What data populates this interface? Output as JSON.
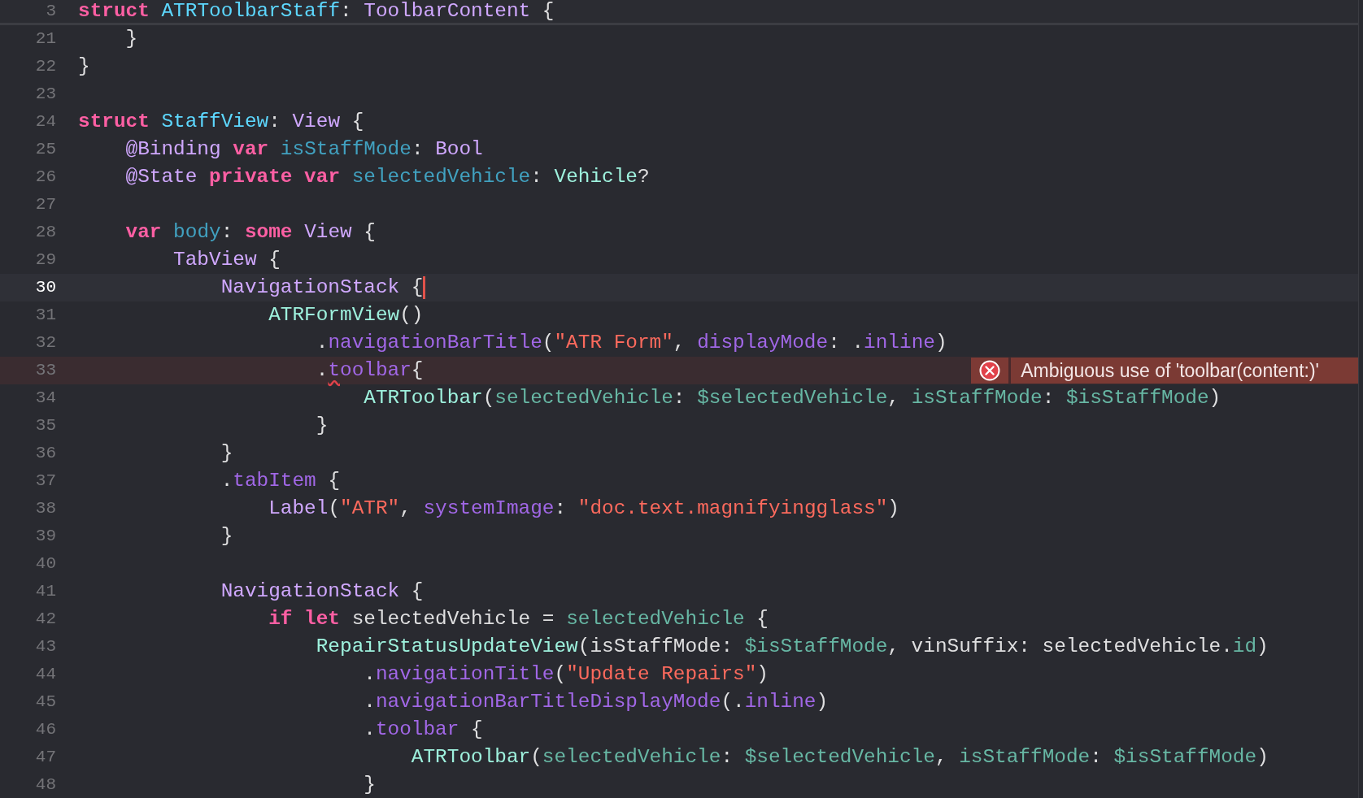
{
  "sticky_header": {
    "number": "3",
    "tokens": [
      {
        "text": "struct",
        "kind": "keyword"
      },
      {
        "text": " ATRToolbarStaff",
        "kind": "decl-type"
      },
      {
        "text": ": ",
        "kind": "plain"
      },
      {
        "text": "ToolbarContent",
        "kind": "sys-type"
      },
      {
        "text": " {",
        "kind": "plain"
      }
    ]
  },
  "lines": [
    {
      "number": "21",
      "current": false,
      "tokens": [
        {
          "text": "    }",
          "kind": "plain"
        }
      ]
    },
    {
      "number": "22",
      "current": false,
      "tokens": [
        {
          "text": "}",
          "kind": "plain"
        }
      ]
    },
    {
      "number": "23",
      "current": false
    },
    {
      "number": "24",
      "current": false,
      "tokens": [
        {
          "text": "struct",
          "kind": "keyword"
        },
        {
          "text": " StaffView",
          "kind": "decl-type"
        },
        {
          "text": ": ",
          "kind": "plain"
        },
        {
          "text": "View",
          "kind": "sys-type"
        },
        {
          "text": " {",
          "kind": "plain"
        }
      ]
    },
    {
      "number": "25",
      "current": false,
      "tokens": [
        {
          "text": "    @Binding",
          "kind": "sys-type"
        },
        {
          "text": " var",
          "kind": "keyword"
        },
        {
          "text": " isStaffMode",
          "kind": "decl-var"
        },
        {
          "text": ": ",
          "kind": "plain"
        },
        {
          "text": "Bool",
          "kind": "sys-type"
        }
      ]
    },
    {
      "number": "26",
      "current": false,
      "tokens": [
        {
          "text": "    @State",
          "kind": "sys-type"
        },
        {
          "text": " private var",
          "kind": "keyword"
        },
        {
          "text": " selectedVehicle",
          "kind": "decl-var"
        },
        {
          "text": ": ",
          "kind": "plain"
        },
        {
          "text": "Vehicle",
          "kind": "proj-type"
        },
        {
          "text": "?",
          "kind": "plain"
        }
      ]
    },
    {
      "number": "27",
      "current": false
    },
    {
      "number": "28",
      "current": false,
      "tokens": [
        {
          "text": "    var",
          "kind": "keyword"
        },
        {
          "text": " body",
          "kind": "decl-var"
        },
        {
          "text": ": ",
          "kind": "plain"
        },
        {
          "text": "some",
          "kind": "keyword"
        },
        {
          "text": " View",
          "kind": "sys-type"
        },
        {
          "text": " {",
          "kind": "plain"
        }
      ]
    },
    {
      "number": "29",
      "current": false,
      "tokens": [
        {
          "text": "        TabView",
          "kind": "sys-type"
        },
        {
          "text": " {",
          "kind": "plain"
        }
      ]
    },
    {
      "number": "30",
      "current": true,
      "tokens": [
        {
          "text": "            NavigationStack",
          "kind": "sys-type"
        },
        {
          "text": " {",
          "kind": "plain"
        }
      ]
    },
    {
      "number": "31",
      "current": false,
      "tokens": [
        {
          "text": "                ATRFormView",
          "kind": "proj-type"
        },
        {
          "text": "()",
          "kind": "plain"
        }
      ]
    },
    {
      "number": "32",
      "current": false,
      "tokens": [
        {
          "text": "                    .",
          "kind": "plain"
        },
        {
          "text": "navigationBarTitle",
          "kind": "sys-member"
        },
        {
          "text": "(",
          "kind": "plain"
        },
        {
          "text": "\"ATR Form\"",
          "kind": "string"
        },
        {
          "text": ", ",
          "kind": "plain"
        },
        {
          "text": "displayMode",
          "kind": "sys-member"
        },
        {
          "text": ": .",
          "kind": "plain"
        },
        {
          "text": "inline",
          "kind": "sys-member"
        },
        {
          "text": ")",
          "kind": "plain"
        }
      ]
    },
    {
      "number": "33",
      "current": false,
      "error": {
        "message": "Ambiguous use of 'toolbar(content:)'"
      },
      "tokens": [
        {
          "text": "                    .",
          "kind": "plain"
        },
        {
          "text": "t",
          "kind": "error-member"
        },
        {
          "text": "oolbar",
          "kind": "sys-member"
        },
        {
          "text": "{",
          "kind": "plain"
        }
      ]
    },
    {
      "number": "34",
      "current": false,
      "tokens": [
        {
          "text": "                        ATRToolbar",
          "kind": "proj-type"
        },
        {
          "text": "(",
          "kind": "plain"
        },
        {
          "text": "selectedVehicle",
          "kind": "proj-member"
        },
        {
          "text": ": ",
          "kind": "plain"
        },
        {
          "text": "$selectedVehicle",
          "kind": "proj-member"
        },
        {
          "text": ", ",
          "kind": "plain"
        },
        {
          "text": "isStaffMode",
          "kind": "proj-member"
        },
        {
          "text": ": ",
          "kind": "plain"
        },
        {
          "text": "$isStaffMode",
          "kind": "proj-member"
        },
        {
          "text": ")",
          "kind": "plain"
        }
      ]
    },
    {
      "number": "35",
      "current": false,
      "tokens": [
        {
          "text": "                    }",
          "kind": "plain"
        }
      ]
    },
    {
      "number": "36",
      "current": false,
      "tokens": [
        {
          "text": "            }",
          "kind": "plain"
        }
      ]
    },
    {
      "number": "37",
      "current": false,
      "tokens": [
        {
          "text": "            .",
          "kind": "plain"
        },
        {
          "text": "tabItem",
          "kind": "sys-member"
        },
        {
          "text": " {",
          "kind": "plain"
        }
      ]
    },
    {
      "number": "38",
      "current": false,
      "tokens": [
        {
          "text": "                Label",
          "kind": "sys-type"
        },
        {
          "text": "(",
          "kind": "plain"
        },
        {
          "text": "\"ATR\"",
          "kind": "string"
        },
        {
          "text": ", ",
          "kind": "plain"
        },
        {
          "text": "systemImage",
          "kind": "sys-member"
        },
        {
          "text": ": ",
          "kind": "plain"
        },
        {
          "text": "\"doc.text.magnifyingglass\"",
          "kind": "string"
        },
        {
          "text": ")",
          "kind": "plain"
        }
      ]
    },
    {
      "number": "39",
      "current": false,
      "tokens": [
        {
          "text": "            }",
          "kind": "plain"
        }
      ]
    },
    {
      "number": "40",
      "current": false
    },
    {
      "number": "41",
      "current": false,
      "tokens": [
        {
          "text": "            NavigationStack",
          "kind": "sys-type"
        },
        {
          "text": " {",
          "kind": "plain"
        }
      ]
    },
    {
      "number": "42",
      "current": false,
      "tokens": [
        {
          "text": "                if let",
          "kind": "keyword"
        },
        {
          "text": " selectedVehicle = ",
          "kind": "plain"
        },
        {
          "text": "selectedVehicle",
          "kind": "proj-member"
        },
        {
          "text": " {",
          "kind": "plain"
        }
      ]
    },
    {
      "number": "43",
      "current": false,
      "tokens": [
        {
          "text": "                    RepairStatusUpdateView",
          "kind": "proj-type"
        },
        {
          "text": "(isStaffMode: ",
          "kind": "plain"
        },
        {
          "text": "$isStaffMode",
          "kind": "proj-member"
        },
        {
          "text": ", vinSuffix: selectedVehicle.",
          "kind": "plain"
        },
        {
          "text": "id",
          "kind": "proj-member"
        },
        {
          "text": ")",
          "kind": "plain"
        }
      ]
    },
    {
      "number": "44",
      "current": false,
      "tokens": [
        {
          "text": "                        .",
          "kind": "plain"
        },
        {
          "text": "navigationTitle",
          "kind": "sys-member"
        },
        {
          "text": "(",
          "kind": "plain"
        },
        {
          "text": "\"Update Repairs\"",
          "kind": "string"
        },
        {
          "text": ")",
          "kind": "plain"
        }
      ]
    },
    {
      "number": "45",
      "current": false,
      "tokens": [
        {
          "text": "                        .",
          "kind": "plain"
        },
        {
          "text": "navigationBarTitleDisplayMode",
          "kind": "sys-member"
        },
        {
          "text": "(.",
          "kind": "plain"
        },
        {
          "text": "inline",
          "kind": "sys-member"
        },
        {
          "text": ")",
          "kind": "plain"
        }
      ]
    },
    {
      "number": "46",
      "current": false,
      "tokens": [
        {
          "text": "                        .",
          "kind": "plain"
        },
        {
          "text": "toolbar",
          "kind": "sys-member"
        },
        {
          "text": " {",
          "kind": "plain"
        }
      ]
    },
    {
      "number": "47",
      "current": false,
      "tokens": [
        {
          "text": "                            ATRToolbar",
          "kind": "proj-type"
        },
        {
          "text": "(",
          "kind": "plain"
        },
        {
          "text": "selectedVehicle",
          "kind": "proj-member"
        },
        {
          "text": ": ",
          "kind": "plain"
        },
        {
          "text": "$selectedVehicle",
          "kind": "proj-member"
        },
        {
          "text": ", ",
          "kind": "plain"
        },
        {
          "text": "isStaffMode",
          "kind": "proj-member"
        },
        {
          "text": ": ",
          "kind": "plain"
        },
        {
          "text": "$isStaffMode",
          "kind": "proj-member"
        },
        {
          "text": ")",
          "kind": "plain"
        }
      ]
    },
    {
      "number": "48",
      "current": false,
      "tokens": [
        {
          "text": "                        }",
          "kind": "plain"
        }
      ]
    }
  ]
}
